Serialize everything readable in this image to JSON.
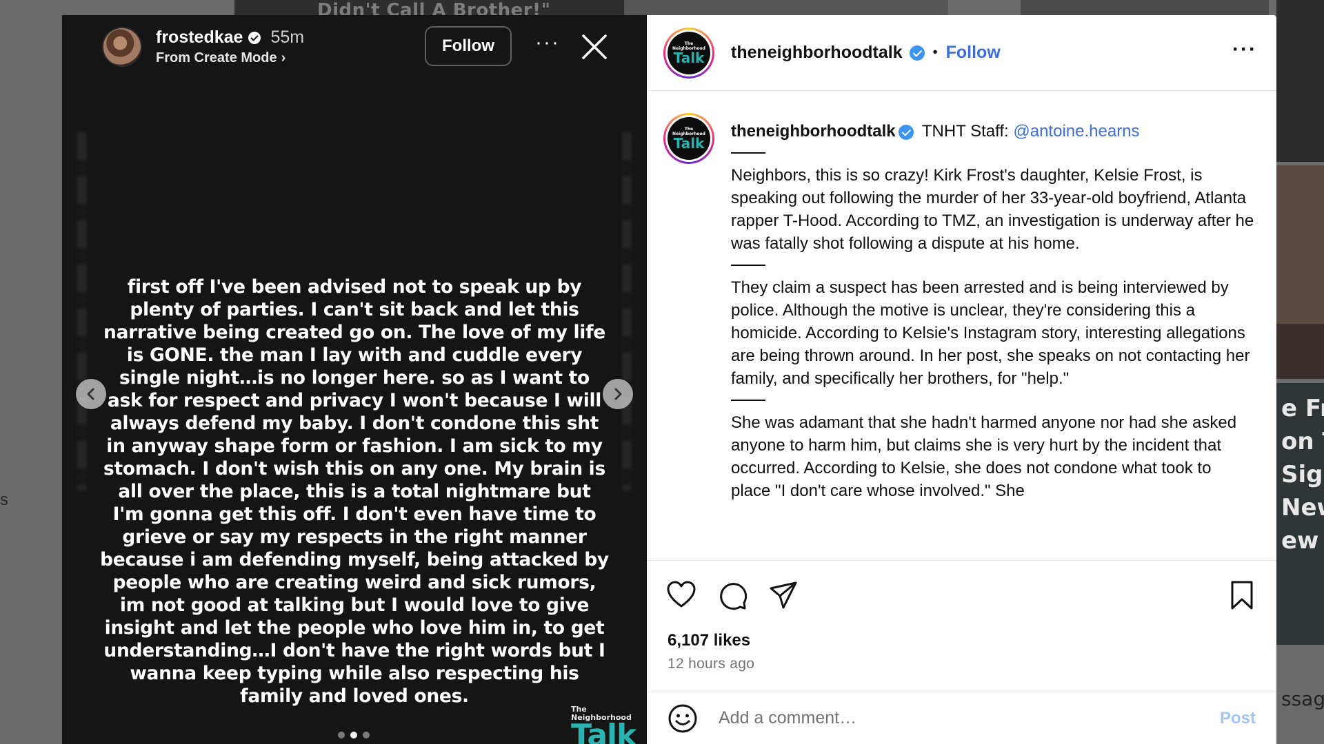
{
  "backdrop": {
    "top_text": "Didn't Call A Brother!\"",
    "left_fragment": "s",
    "right_fragments": [
      "e Fro",
      "on Ti",
      "Sign",
      "New",
      "ew"
    ],
    "right_bottom": "ssage"
  },
  "story": {
    "username": "frostedkae",
    "time": "55m",
    "subtitle": "From Create Mode",
    "subtitle_chevron": "›",
    "follow_label": "Follow",
    "more_label": "···",
    "text": "first off I've been advised not to speak up by plenty of parties. I can't sit back and let this narrative being created go on. The love of my life is GONE. the man I lay with and cuddle every single night…is no longer here. so as I want to ask for respect and privacy I won't because I will always defend my baby. I don't condone this sht in anyway shape form or fashion. I am sick to my stomach. I don't wish this on any one. My brain is all over the place, this is a total nightmare but I'm gonna get this off.  I don't even have time to grieve or say my respects in the right manner because i am defending myself, being attacked by people who are creating weird and sick rumors, im not good at talking but I would love to give insight and let the people who love him in, to get understanding…I don't have the right words but I wanna keep typing while also respecting his family and loved ones.",
    "watermark_small_1": "The",
    "watermark_small_2": "Neighborhood",
    "watermark_big": "Talk",
    "dots": 3,
    "active_dot": 1
  },
  "post": {
    "header_username": "theneighborhoodtalk",
    "header_dot": "•",
    "header_follow": "Follow",
    "more_label": "···",
    "avatar_small_1": "The",
    "avatar_small_2": "Neighborhood",
    "avatar_big": "Talk",
    "caption_username": "theneighborhoodtalk",
    "caption_intro": " TNHT Staff: ",
    "caption_mention": "@antoine.hearns",
    "paragraph_1": "Neighbors, this is so crazy! Kirk Frost's daughter, Kelsie Frost, is speaking out following the murder of her 33-year-old boyfriend, Atlanta rapper T-Hood. According to TMZ, an investigation is underway after he was fatally shot following a dispute at his home.",
    "paragraph_2": "They claim a suspect has been arrested and is being interviewed by police. Although the motive is unclear, they're considering this a homicide. According to Kelsie's Instagram story, interesting allegations are being thrown around. In her post, she speaks on not contacting her family, and specifically her brothers, for \"help.\"",
    "paragraph_3": "She was adamant that she hadn't harmed anyone nor had she asked anyone to harm him, but claims she is very hurt by the incident that occurred. According to Kelsie, she does not condone what took to place \"I don't care whose involved.\" She",
    "likes": "6,107 likes",
    "time_ago": "12 hours ago",
    "comment_placeholder": "Add a comment…",
    "post_label": "Post",
    "post_color": "#a4c4f4",
    "accent": "#3d6ee0"
  },
  "icons": [
    "heart-icon",
    "comment-icon",
    "share-icon",
    "bookmark-icon",
    "emoji-icon",
    "close-icon",
    "chevron-left-icon",
    "chevron-right-icon",
    "verified-icon"
  ]
}
